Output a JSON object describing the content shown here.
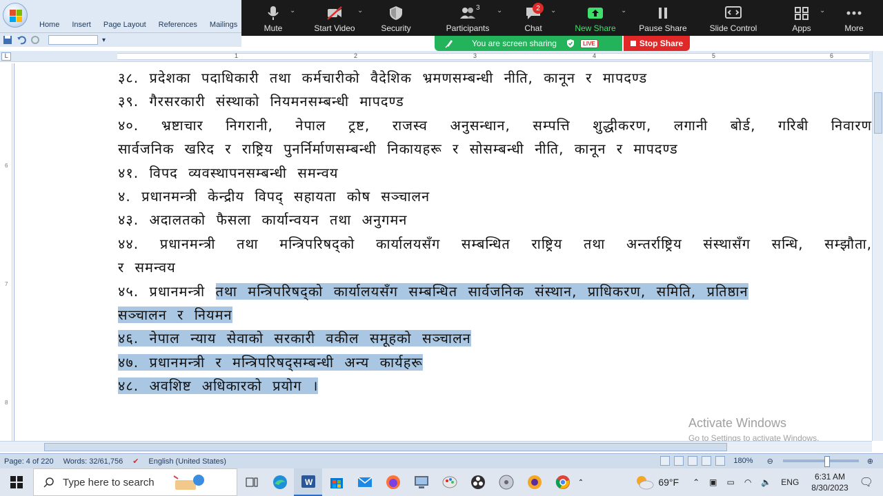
{
  "ribbon": {
    "tabs": [
      "Home",
      "Insert",
      "Page Layout",
      "References",
      "Mailings"
    ]
  },
  "zoom": {
    "items": [
      {
        "label": "Mute",
        "icon": "microphone-icon"
      },
      {
        "label": "Start Video",
        "icon": "video-off-icon"
      },
      {
        "label": "Security",
        "icon": "shield-icon"
      },
      {
        "label": "Participants",
        "icon": "participants-icon",
        "count": "3"
      },
      {
        "label": "Chat",
        "icon": "chat-icon",
        "badge": "2"
      },
      {
        "label": "New Share",
        "icon": "share-up-arrow-icon"
      },
      {
        "label": "Pause Share",
        "icon": "pause-icon"
      },
      {
        "label": "Slide Control",
        "icon": "slide-control-icon"
      },
      {
        "label": "Apps",
        "icon": "apps-icon"
      },
      {
        "label": "More",
        "icon": "more-dots-icon"
      }
    ],
    "sharing_text": "You are screen sharing",
    "live_label": "LIVE",
    "stop_share_label": "Stop Share",
    "accent_green": "#23b35a",
    "accent_red": "#e02828"
  },
  "ruler": {
    "numbers": [
      "1",
      "2",
      "3",
      "4",
      "5",
      "6"
    ],
    "vertical_numbers": [
      "6",
      "7",
      "8"
    ]
  },
  "document": {
    "lines": [
      {
        "text": "३८. प्रदेशका पदाधिकारी तथा कर्मचारीको वैदेशिक भ्रमणसम्बन्धी नीति, कानून र मापदण्ड"
      },
      {
        "text": "३९. गैरसरकारी संस्थाको नियमनसम्बन्धी मापदण्ड"
      },
      {
        "text": "४०. भ्रष्टाचार निगरानी, नेपाल ट्रष्ट, राजस्व अनुसन्धान, सम्पत्ति शुद्धीकरण, लगानी बोर्ड, गरिबी निवारण"
      },
      {
        "text": "सार्वजनिक खरिद र राष्ट्रिय पुनर्निर्माणसम्बन्धी निकायहरू र सोसम्बन्धी नीति, कानून र मापदण्ड"
      },
      {
        "text": "४१. विपद व्यवस्थापनसम्बन्धी समन्वय"
      },
      {
        "text": "४. प्रधानमन्त्री केन्द्रीय विपद् सहायता कोष सञ्चालन"
      },
      {
        "text": "४३. अदालतको फैसला कार्यान्वयन तथा अनुगमन"
      },
      {
        "text": "४४. प्रधानमन्त्री तथा मन्त्रिपरिषद्को कार्यालयसँग सम्बन्धित राष्ट्रिय तथा अन्तर्राष्ट्रिय संस्थासँग सन्धि, सम्झौता,"
      },
      {
        "text": "र समन्वय"
      },
      {
        "pre": "४५. प्रधानमन्त्री ",
        "sel": "तथा मन्त्रिपरिषद्को कार्यालयसँग सम्बन्धित सार्वजनिक संस्थान, प्राधिकरण, समिति, प्रतिष्ठान"
      },
      {
        "sel": "सञ्चालन र नियमन"
      },
      {
        "sel": "४६. नेपाल न्याय सेवाको सरकारी वकील समूहको सञ्चालन"
      },
      {
        "sel": "४७. प्रधानमन्त्री र मन्त्रिपरिषद्सम्बन्धी अन्य कार्यहरू"
      },
      {
        "sel": "४८. अवशिष्ट अधिकारको प्रयोग ।"
      }
    ]
  },
  "watermark": {
    "title": "Activate Windows",
    "subtitle": "Go to Settings to activate Windows."
  },
  "status": {
    "page": "Page: 4 of 220",
    "words": "Words: 32/61,756",
    "language": "English (United States)",
    "zoom": "180%"
  },
  "taskbar": {
    "search_placeholder": "Type here to search",
    "weather": "69°F",
    "lang": "ENG",
    "time": "6:31 AM",
    "date": "8/30/2023"
  }
}
